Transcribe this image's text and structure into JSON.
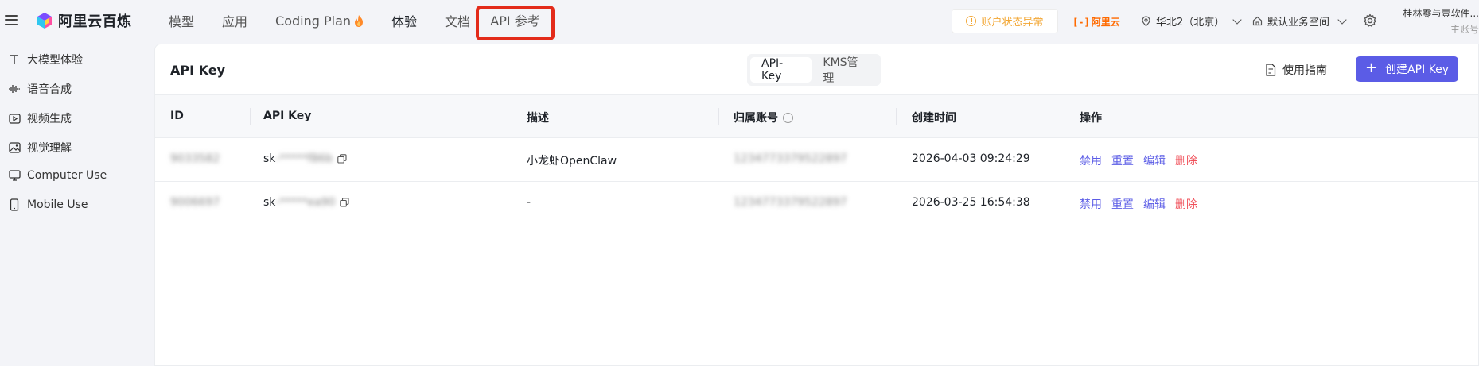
{
  "topbar": {
    "logo_text": "阿里云百炼",
    "nav": [
      {
        "label": "模型"
      },
      {
        "label": "应用"
      },
      {
        "label": "Coding Plan"
      },
      {
        "label": "体验"
      },
      {
        "label": "文档"
      },
      {
        "label": "API 参考"
      }
    ],
    "account_status": "账户状态异常",
    "aliyun_logo": "阿里云",
    "region": "华北2（北京）",
    "workspace": "默认业务空间",
    "account_name": "桂林零与壹软件...",
    "account_role": "主账号",
    "colors": {
      "highlight_border": "#e32b1a",
      "warning": "#f2a531",
      "aliyun": "#ff6a00"
    }
  },
  "sidebar": {
    "items": [
      {
        "label": "大模型体验",
        "icon": "text-t-icon"
      },
      {
        "label": "语音合成",
        "icon": "waveform-icon"
      },
      {
        "label": "视频生成",
        "icon": "video-icon"
      },
      {
        "label": "视觉理解",
        "icon": "image-icon"
      },
      {
        "label": "Computer Use",
        "icon": "monitor-icon"
      },
      {
        "label": "Mobile Use",
        "icon": "mobile-icon"
      }
    ]
  },
  "main": {
    "title": "API Key",
    "tabs": [
      {
        "label": "API-Key",
        "active": true
      },
      {
        "label": "KMS管理",
        "active": false
      }
    ],
    "guide_label": "使用指南",
    "create_label": "创建API Key",
    "accent": "#5b5ce6"
  },
  "table": {
    "headers": [
      "ID",
      "API Key",
      "描述",
      "归属账号",
      "创建时间",
      "操作"
    ],
    "rows": [
      {
        "id": "9033582",
        "key_prefix": "sk",
        "key_masked": "-*****f86b",
        "desc": "小龙虾OpenClaw",
        "owner": "1234773379522897",
        "created": "2026-04-03 09:24:29",
        "ops": [
          "禁用",
          "重置",
          "编辑",
          "删除"
        ]
      },
      {
        "id": "9006697",
        "key_prefix": "sk",
        "key_masked": "-*****ea90",
        "desc": "-",
        "owner": "1234773379522897",
        "created": "2026-03-25 16:54:38",
        "ops": [
          "禁用",
          "重置",
          "编辑",
          "删除"
        ]
      }
    ]
  }
}
